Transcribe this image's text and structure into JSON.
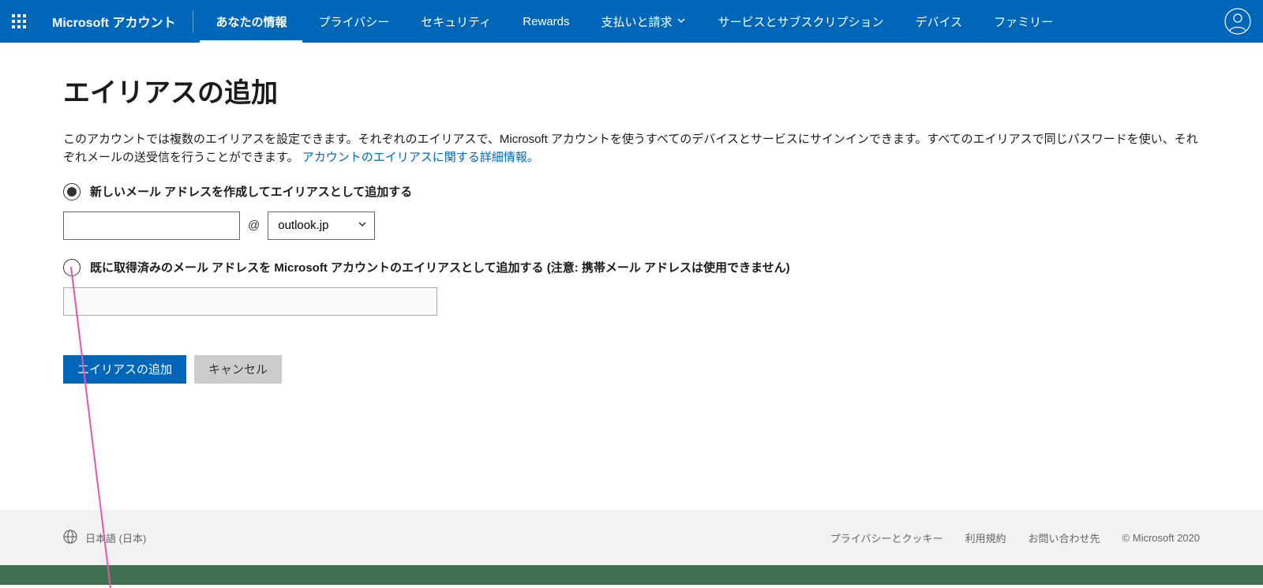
{
  "header": {
    "brand": "Microsoft アカウント",
    "nav": [
      {
        "label": "あなたの情報",
        "active": true,
        "hasDropdown": false
      },
      {
        "label": "プライバシー",
        "active": false,
        "hasDropdown": false
      },
      {
        "label": "セキュリティ",
        "active": false,
        "hasDropdown": false
      },
      {
        "label": "Rewards",
        "active": false,
        "hasDropdown": false
      },
      {
        "label": "支払いと請求",
        "active": false,
        "hasDropdown": true
      },
      {
        "label": "サービスとサブスクリプション",
        "active": false,
        "hasDropdown": false
      },
      {
        "label": "デバイス",
        "active": false,
        "hasDropdown": false
      },
      {
        "label": "ファミリー",
        "active": false,
        "hasDropdown": false
      }
    ]
  },
  "page": {
    "title": "エイリアスの追加",
    "descriptionPrefix": "このアカウントでは複数のエイリアスを設定できます。それぞれのエイリアスで、Microsoft アカウントを使うすべてのデバイスとサービスにサインインできます。すべてのエイリアスで同じパスワードを使い、それぞれメールの送受信を行うことができます。",
    "descriptionLink": "アカウントのエイリアスに関する詳細情報。"
  },
  "form": {
    "option1Label": "新しいメール アドレスを作成してエイリアスとして追加する",
    "option2Label": "既に取得済みのメール アドレスを Microsoft アカウントのエイリアスとして追加する (注意: 携帯メール アドレスは使用できません)",
    "atSign": "@",
    "domainSelected": "outlook.jp",
    "newEmailValue": "",
    "existingEmailValue": "",
    "submitLabel": "エイリアスの追加",
    "cancelLabel": "キャンセル"
  },
  "footer": {
    "locale": "日本語 (日本)",
    "links": {
      "privacy": "プライバシーとクッキー",
      "terms": "利用規約",
      "contact": "お問い合わせ先"
    },
    "copyright": "© Microsoft 2020"
  }
}
